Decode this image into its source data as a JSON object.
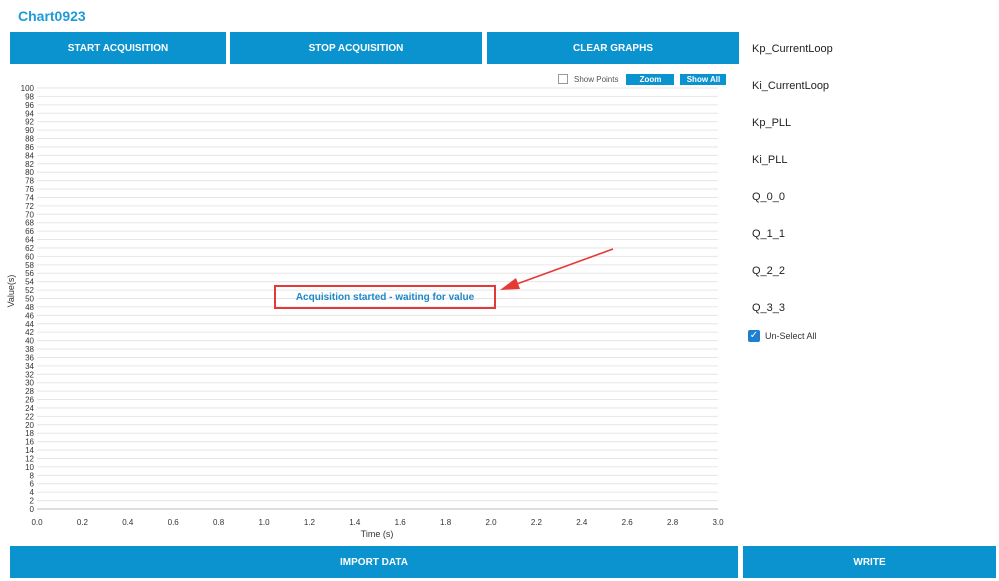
{
  "app": {
    "title": "Chart0923"
  },
  "toolbar": {
    "start_label": "START ACQUISITION",
    "stop_label": "STOP ACQUISITION",
    "clear_label": "CLEAR GRAPHS"
  },
  "chart_controls": {
    "show_points_label": "Show Points",
    "show_points_checked": false,
    "zoom_label": "Zoom",
    "show_all_label": "Show All"
  },
  "chart_data": {
    "type": "line",
    "series": [],
    "xlabel": "Time (s)",
    "ylabel": "Value(s)",
    "xlim": [
      0.0,
      3.0
    ],
    "ylim": [
      0,
      100
    ],
    "x_ticks": [
      "0.0",
      "0.2",
      "0.4",
      "0.6",
      "0.8",
      "1.0",
      "1.2",
      "1.4",
      "1.6",
      "1.8",
      "2.0",
      "2.2",
      "2.4",
      "2.6",
      "2.8",
      "3.0"
    ],
    "y_ticks": [
      "0",
      "2",
      "4",
      "6",
      "8",
      "10",
      "12",
      "14",
      "16",
      "18",
      "20",
      "22",
      "24",
      "26",
      "28",
      "30",
      "32",
      "34",
      "36",
      "38",
      "40",
      "42",
      "44",
      "46",
      "48",
      "50",
      "52",
      "54",
      "56",
      "58",
      "60",
      "62",
      "64",
      "66",
      "68",
      "70",
      "72",
      "74",
      "76",
      "78",
      "80",
      "82",
      "84",
      "86",
      "88",
      "90",
      "92",
      "94",
      "96",
      "98",
      "100"
    ],
    "grid": true,
    "status_message": "Acquisition started - waiting for value",
    "annotation_color": "#e53935"
  },
  "signals": {
    "items": [
      {
        "label": "Kp_CurrentLoop"
      },
      {
        "label": "Ki_CurrentLoop"
      },
      {
        "label": "Kp_PLL"
      },
      {
        "label": "Ki_PLL"
      },
      {
        "label": "Q_0_0"
      },
      {
        "label": "Q_1_1"
      },
      {
        "label": "Q_2_2"
      },
      {
        "label": "Q_3_3"
      }
    ],
    "unselect_label": "Un-Select All",
    "unselect_checked": true
  },
  "footer": {
    "import_label": "IMPORT DATA",
    "write_label": "WRITE"
  },
  "colors": {
    "accent": "#0a93cf",
    "title": "#1e9bd7",
    "grid": "#e6e6e6",
    "checkbox": "#1e7fd0"
  }
}
